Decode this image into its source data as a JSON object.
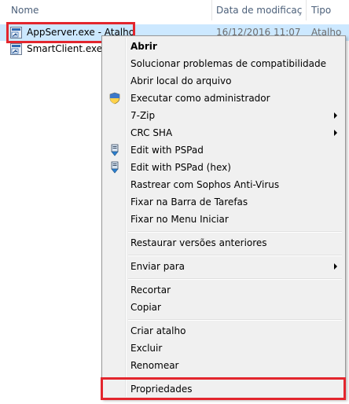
{
  "columns": {
    "name": "Nome",
    "date": "Data de modificaç...",
    "type": "Tipo"
  },
  "files": [
    {
      "name": "AppServer.exe - Atalho",
      "date": "16/12/2016 11:07",
      "type": "Atalho"
    },
    {
      "name": "SmartClient.exe -"
    }
  ],
  "menu": {
    "open": "Abrir",
    "troubleshoot": "Solucionar problemas de compatibilidade",
    "open_location": "Abrir local do arquivo",
    "run_as_admin": "Executar como administrador",
    "seven_zip": "7-Zip",
    "crc_sha": "CRC SHA",
    "edit_pspad": "Edit with PSPad",
    "edit_pspad_hex": "Edit with PSPad (hex)",
    "sophos_scan": "Rastrear com Sophos Anti-Virus",
    "pin_taskbar": "Fixar na Barra de Tarefas",
    "pin_start": "Fixar no Menu Iniciar",
    "restore_versions": "Restaurar versões anteriores",
    "send_to": "Enviar para",
    "cut": "Recortar",
    "copy": "Copiar",
    "create_shortcut": "Criar atalho",
    "delete": "Excluir",
    "rename": "Renomear",
    "properties": "Propriedades"
  },
  "colors": {
    "highlight_box": "#e3262d",
    "selection": "#cce8ff",
    "menu_background": "#f0f0f0"
  },
  "icons": {
    "shortcut": "shortcut-icon",
    "shield": "uac-shield-icon",
    "pspad": "pspad-icon"
  }
}
